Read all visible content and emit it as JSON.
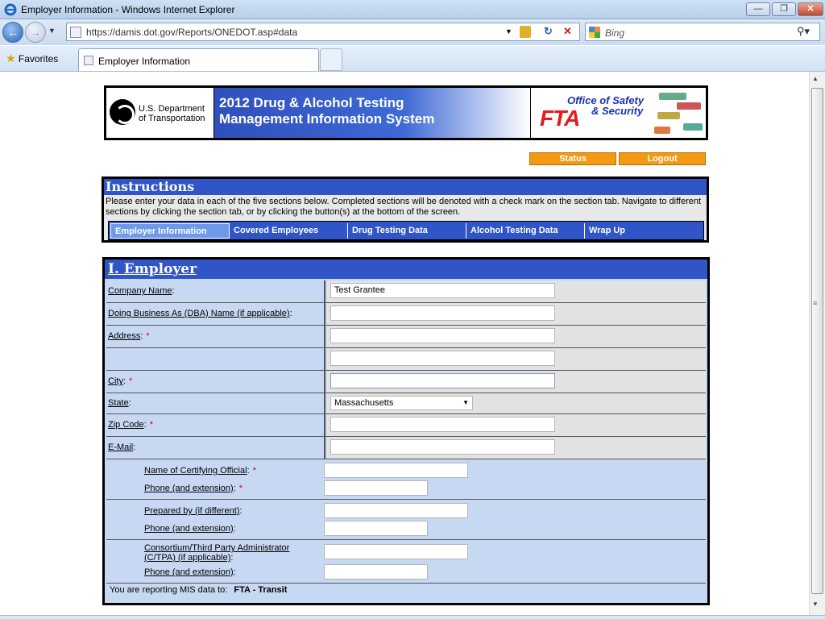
{
  "window": {
    "title": "Employer Information - Windows Internet Explorer"
  },
  "browser": {
    "url": "https://damis.dot.gov/Reports/ONEDOT.asp#data",
    "search_placeholder": "Bing",
    "favorites_label": "Favorites",
    "tab_label": "Employer Information"
  },
  "banner": {
    "dot_line1": "U.S. Department",
    "dot_line2": "of Transportation",
    "title_line1": "2012 Drug & Alcohol Testing",
    "title_line2": "Management Information System",
    "fta_line1": "Office of Safety",
    "fta_line2": "& Security",
    "fta_logo": "FTA"
  },
  "toolbar": {
    "status_label": "Status",
    "logout_label": "Logout"
  },
  "instructions": {
    "heading": "Instructions",
    "text": "Please enter your data in each of the five sections below.  Completed sections will be denoted with a check mark on the section tab.  Navigate to different sections by clicking the section tab, or by clicking the button(s) at the bottom of the screen."
  },
  "section_tabs": [
    {
      "label": "Employer Information"
    },
    {
      "label": "Covered Employees"
    },
    {
      "label": "Drug Testing Data"
    },
    {
      "label": "Alcohol Testing Data"
    },
    {
      "label": "Wrap Up"
    }
  ],
  "form": {
    "heading": "I. Employer",
    "company_name": {
      "label": "Company Name",
      "value": "Test Grantee"
    },
    "dba": {
      "label": "Doing Business As (DBA) Name (if applicable)",
      "value": ""
    },
    "address": {
      "label": "Address",
      "value1": "",
      "value2": ""
    },
    "city": {
      "label": "City",
      "value": ""
    },
    "state": {
      "label": "State",
      "value": "Massachusetts"
    },
    "zip": {
      "label": "Zip Code",
      "value": ""
    },
    "email": {
      "label": "E-Mail",
      "value": ""
    },
    "certifying_official": {
      "label": "Name of Certifying Official",
      "value": ""
    },
    "phone1": {
      "label": "Phone (and extension)",
      "value": ""
    },
    "prepared_by": {
      "label": "Prepared by (if different)",
      "value": ""
    },
    "phone2": {
      "label": "Phone (and extension)",
      "value": ""
    },
    "consortium_line1": "Consortium/Third Party Administrator",
    "consortium_line2": "(C/TPA) (if applicable)",
    "consortium_value": "",
    "phone3": {
      "label": "Phone (and extension)",
      "value": ""
    },
    "required_marker": "*",
    "colon": ":",
    "reporting_text": "You are reporting MIS data to:",
    "reporting_agency": "FTA - Transit"
  },
  "colors": {
    "header_blue": "#2f55c9",
    "form_bg": "#c7d8f3",
    "orange_button": "#f29a14",
    "fta_red": "#e21b1b"
  }
}
